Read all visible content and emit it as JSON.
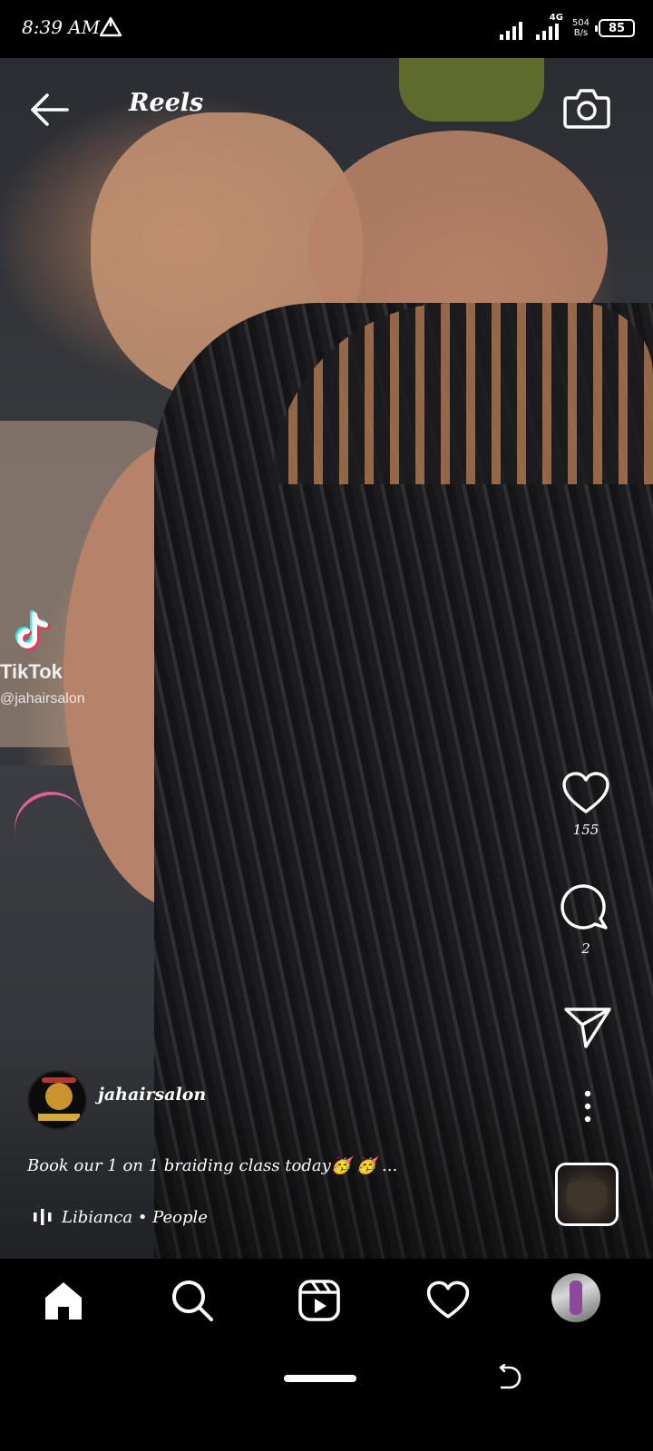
{
  "status_bar": {
    "time": "8:39 AM",
    "network": "4G",
    "speed_top": "504",
    "speed_bottom": "B/s",
    "battery": "85"
  },
  "header": {
    "title": "Reels",
    "back_icon": "arrow-left-icon",
    "camera_icon": "camera-icon"
  },
  "watermark": {
    "brand": "TikTok",
    "handle": "@jahairsalon"
  },
  "actions": {
    "likes": "155",
    "comments": "2",
    "like_icon": "heart-outline-icon",
    "comment_icon": "comment-bubble-icon",
    "share_icon": "paper-plane-icon",
    "more_icon": "more-vertical-icon"
  },
  "post": {
    "username": "jahairsalon",
    "caption": "Book our 1 on 1 braiding class today🥳 🥳 ...",
    "audio": "Libianca • People"
  },
  "bottom_nav": {
    "items": [
      "home-icon",
      "search-icon",
      "reels-icon",
      "heart-icon",
      "profile-avatar"
    ]
  },
  "colors": {
    "background": "#000000",
    "text": "#ffffff",
    "tiktok_cyan": "#25f4ee",
    "tiktok_pink": "#fe2c55"
  }
}
